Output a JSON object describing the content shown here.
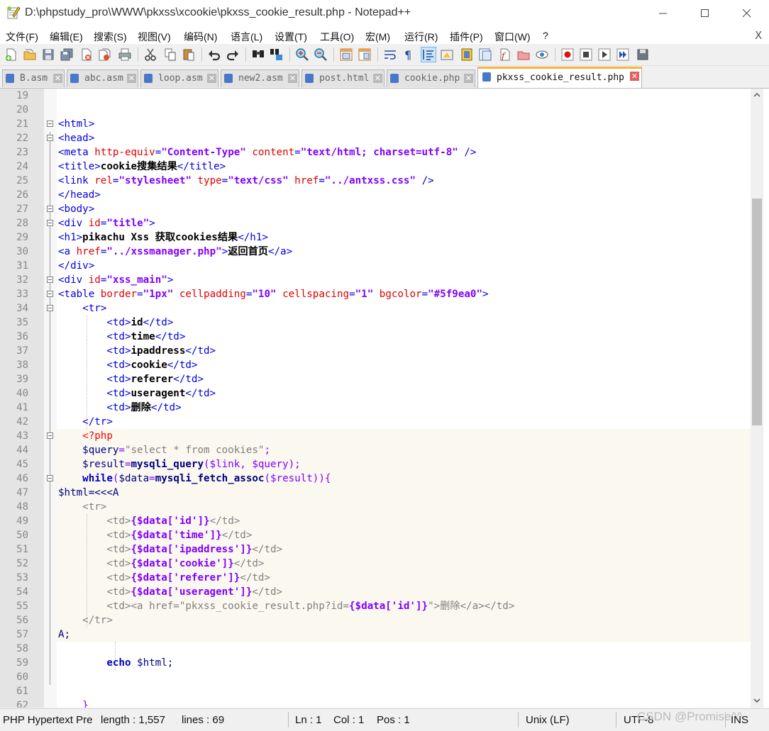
{
  "window": {
    "title": "D:\\phpstudy_pro\\WWW\\pkxss\\xcookie\\pkxss_cookie_result.php - Notepad++",
    "minimize": "—",
    "maximize": "☐",
    "close": "✕"
  },
  "menu": {
    "items": [
      "文件(F)",
      "编辑(E)",
      "搜索(S)",
      "视图(V)",
      "编码(N)",
      "语言(L)",
      "设置(T)",
      "工具(O)",
      "宏(M)",
      "运行(R)",
      "插件(P)",
      "窗口(W)",
      "?"
    ],
    "doc_close": "X"
  },
  "toolbar": {
    "icons": [
      "new-file-icon",
      "open-file-icon",
      "save-icon",
      "save-all-icon",
      "close-icon",
      "close-all-icon",
      "print-icon",
      "cut-icon",
      "copy-icon",
      "paste-icon",
      "undo-icon",
      "redo-icon",
      "find-icon",
      "replace-icon",
      "zoom-in-icon",
      "zoom-out-icon",
      "sync-v-icon",
      "sync-h-icon",
      "word-wrap-icon",
      "show-all-chars-icon",
      "indent-guide-icon",
      "udl-icon",
      "doc-map-icon",
      "function-list-icon",
      "folder-workspace-icon",
      "folder-icon",
      "monitor-icon",
      "record-macro-icon",
      "stop-macro-icon",
      "play-macro-icon",
      "run-macro-multiple-icon",
      "save-macro-icon"
    ]
  },
  "tabs": [
    {
      "label": "B.asm",
      "active": false
    },
    {
      "label": "abc.asm",
      "active": false
    },
    {
      "label": "loop.asm",
      "active": false
    },
    {
      "label": "new2.asm",
      "active": false
    },
    {
      "label": "post.html",
      "active": false
    },
    {
      "label": "cookie.php",
      "active": false
    },
    {
      "label": "pkxss_cookie_result.php",
      "active": true
    }
  ],
  "editor": {
    "line_numbers": [
      "19",
      "20",
      "21",
      "22",
      "23",
      "24",
      "25",
      "26",
      "27",
      "28",
      "29",
      "30",
      "31",
      "32",
      "33",
      "34",
      "35",
      "36",
      "37",
      "38",
      "39",
      "40",
      "41",
      "42",
      "43",
      "44",
      "45",
      "46",
      "47",
      "48",
      "49",
      "50",
      "51",
      "52",
      "53",
      "54",
      "55",
      "56",
      "57",
      "58",
      "59",
      "60",
      "61",
      "62"
    ],
    "td_headers": [
      "id",
      "time",
      "ipaddress",
      "cookie",
      "referer",
      "useragent",
      "删除"
    ],
    "data_keys": [
      "'id'",
      "'time'",
      "'ipaddress'",
      "'cookie'",
      "'referer'",
      "'useragent'"
    ],
    "text": {
      "html_open": "<html>",
      "head_open": "<head>",
      "meta_tag": "<meta",
      "meta_attr1": "http-equiv",
      "meta_val1": "\"Content-Type\"",
      "meta_attr2": "content",
      "meta_val2": "\"text/html; charset=utf-8\"",
      "self_close": "/>",
      "title_open": "<title>",
      "title_text": "cookie搜集结果",
      "title_close": "</title>",
      "link_tag": "<link",
      "link_attr1": "rel",
      "link_val1": "\"stylesheet\"",
      "link_attr2": "type",
      "link_val2": "\"text/css\"",
      "link_attr3": "href",
      "link_val3": "\"../antxss.css\"",
      "head_close": "</head>",
      "body_open": "<body>",
      "div_tag": "<div",
      "id_attr": "id",
      "div_title_val": "\"title\"",
      "gt": ">",
      "eq": "=",
      "h1_open": "<h1>",
      "h1_text": "pikachu Xss 获取cookies结果",
      "h1_close": "</h1>",
      "a_tag": "<a",
      "href_attr": "href",
      "a_href_val": "\"../xssmanager.php\"",
      "a_text": "返回首页",
      "a_close": "</a>",
      "div_close": "</div>",
      "div_main_val": "\"xss_main\"",
      "table_tag": "<table",
      "t_attr1": "border",
      "t_val1": "\"1px\"",
      "t_attr2": "cellpadding",
      "t_val2": "\"10\"",
      "t_attr3": "cellspacing",
      "t_val3": "\"1\"",
      "t_attr4": "bgcolor",
      "t_val4": "\"#5f9ea0\"",
      "tr_open": "<tr>",
      "tr_close": "</tr>",
      "td_open": "<td>",
      "td_close": "</td>",
      "php_open": "<?php",
      "query_var": "$query",
      "query_str": "\"select * from cookies\"",
      "semicolon": ";",
      "result_var": "$result",
      "fn_query": "mysqli_query",
      "query_args": "($link, $query);",
      "while_kw": "while",
      "while_open": "(",
      "data_var": "$data",
      "fn_fetch": "mysqli_fetch_assoc",
      "fetch_args": "($result)){",
      "heredoc_start": "$html=<<<A",
      "h_data": "{$data[",
      "h_close": "]}",
      "del_open": "<td><a href=\"pkxss_cookie_result.php?id=",
      "del_mid": "{$data['id']}",
      "del_end": "\">删除</a></td>",
      "heredoc_end": "A;",
      "echo_kw": "echo",
      "echo_rest": " $html;",
      "last_line": "}"
    }
  },
  "status": {
    "lang": "PHP Hypertext Pre",
    "length": "length : 1,557",
    "lines": "lines : 69",
    "ln": "Ln : 1",
    "col": "Col : 1",
    "pos": "Pos : 1",
    "eol": "Unix (LF)",
    "enc": "UTF-8",
    "mode": "INS"
  },
  "watermark": "CSDN @Promise^^"
}
